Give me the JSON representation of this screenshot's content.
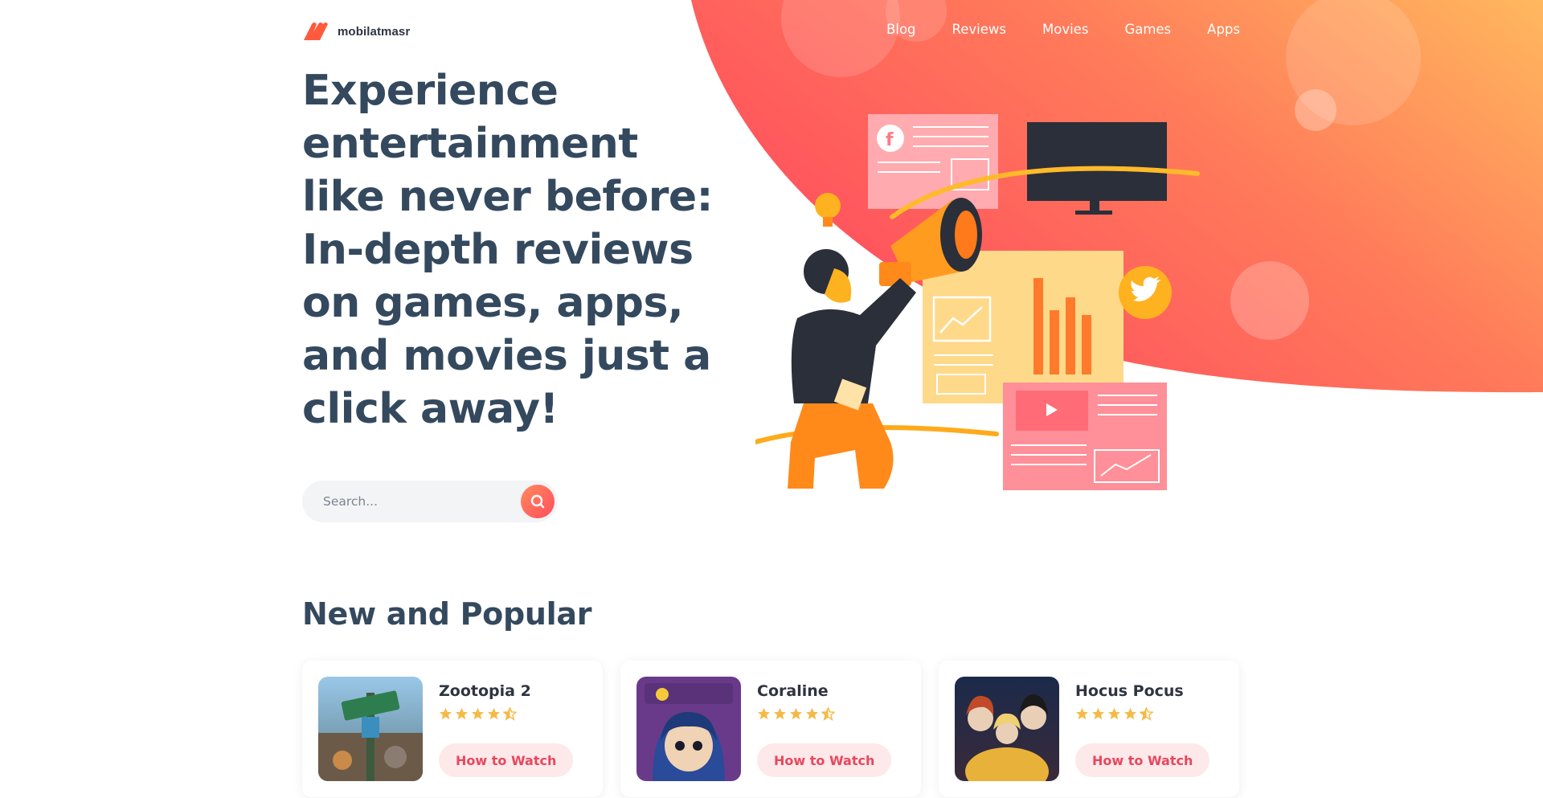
{
  "brand": {
    "name": "mobilatmasr",
    "accent": "#ff5a5f",
    "gradient_start": "#ff4d5e",
    "gradient_end": "#ffb35c"
  },
  "nav": {
    "items": [
      "Blog",
      "Reviews",
      "Movies",
      "Games",
      "Apps"
    ]
  },
  "hero": {
    "title": "Experience entertainment like never before: In-depth reviews on games, apps, and movies just a click away!",
    "search_placeholder": "Search...",
    "search_icon": "search-icon"
  },
  "section": {
    "title": "New and Popular",
    "cards": [
      {
        "title": "Zootopia 2",
        "rating": 4.5,
        "button": "How to Watch"
      },
      {
        "title": "Coraline",
        "rating": 4.5,
        "button": "How to Watch"
      },
      {
        "title": "Hocus Pocus",
        "rating": 4.5,
        "button": "How to Watch"
      }
    ]
  },
  "colors": {
    "text_dark": "#34495e",
    "button_bg": "#fde8ea",
    "button_text": "#e8475c",
    "star": "#f5b945"
  }
}
